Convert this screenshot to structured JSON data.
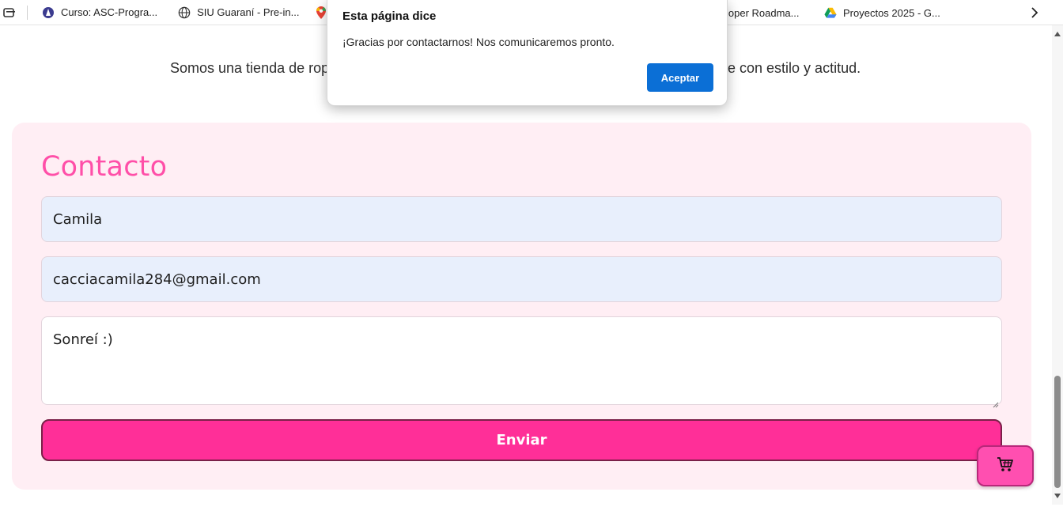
{
  "bookmarks": {
    "items": [
      {
        "label": "Curso: ASC-Progra...",
        "icon": "course-icon"
      },
      {
        "label": "SIU Guaraní - Pre-in...",
        "icon": "globe-icon"
      },
      {
        "label": "",
        "icon": "maps-pin-icon"
      },
      {
        "label": "loper Roadma...",
        "icon": ""
      },
      {
        "label": "Proyectos 2025 - G...",
        "icon": "google-drive-icon"
      }
    ]
  },
  "about": {
    "text_left": "Somos una tienda de rop",
    "text_right": "e con estilo y actitud."
  },
  "contact": {
    "title": "Contacto",
    "name_value": "Camila",
    "email_value": "cacciacamila284@gmail.com",
    "message_value": "Sonreí :)",
    "submit_label": "Enviar"
  },
  "cart": {
    "icon": "cart-icon"
  },
  "dialog": {
    "title": "Esta página dice",
    "message": "¡Gracias por contactarnos! Nos comunicaremos pronto.",
    "button_label": "Aceptar"
  },
  "colors": {
    "accent_pink": "#ff2f98",
    "title_pink": "#ff4fa8",
    "contact_bg": "#ffeef4",
    "dialog_button": "#0b6fd6"
  }
}
